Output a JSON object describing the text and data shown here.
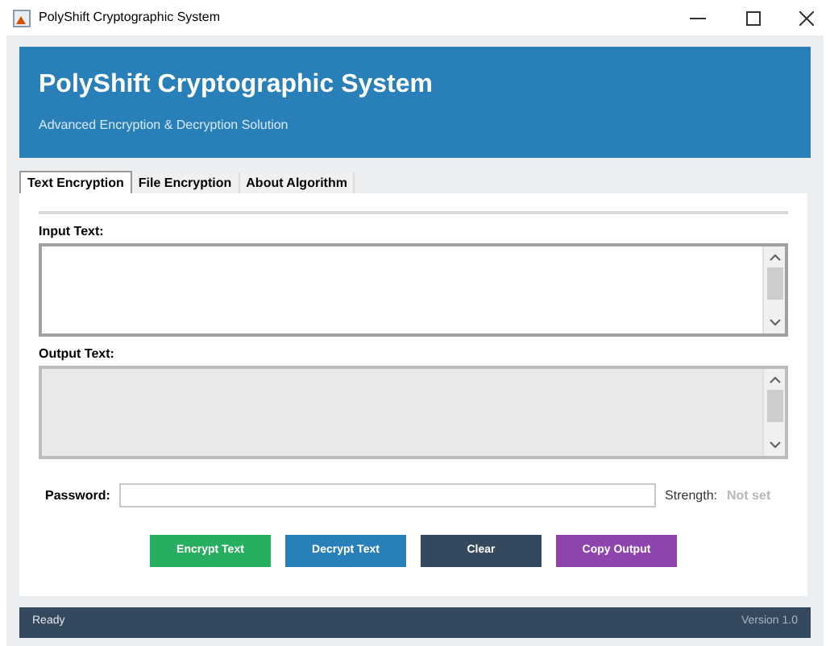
{
  "window": {
    "title": "PolyShift Cryptographic System"
  },
  "header": {
    "title": "PolyShift Cryptographic System",
    "subtitle": "Advanced Encryption & Decryption Solution"
  },
  "tabs": [
    {
      "label": "Text Encryption",
      "selected": true
    },
    {
      "label": "File Encryption",
      "selected": false
    },
    {
      "label": "About Algorithm",
      "selected": false
    }
  ],
  "text_areas": [
    {
      "label": "Input Text:",
      "disabled": false
    },
    {
      "label": "Output Text:",
      "disabled": true
    }
  ],
  "password": {
    "label": "Password:",
    "strength_label": "Strength:",
    "strength_value": "Not set"
  },
  "buttons": [
    {
      "label": "Encrypt Text",
      "color": "#27ae60"
    },
    {
      "label": "Decrypt Text",
      "color": "#2980b9"
    },
    {
      "label": "Clear",
      "color": "#34495e"
    },
    {
      "label": "Copy Output",
      "color": "#8e44ad"
    }
  ],
  "status_bar": {
    "status": "Ready",
    "version": "Version 1.0"
  }
}
